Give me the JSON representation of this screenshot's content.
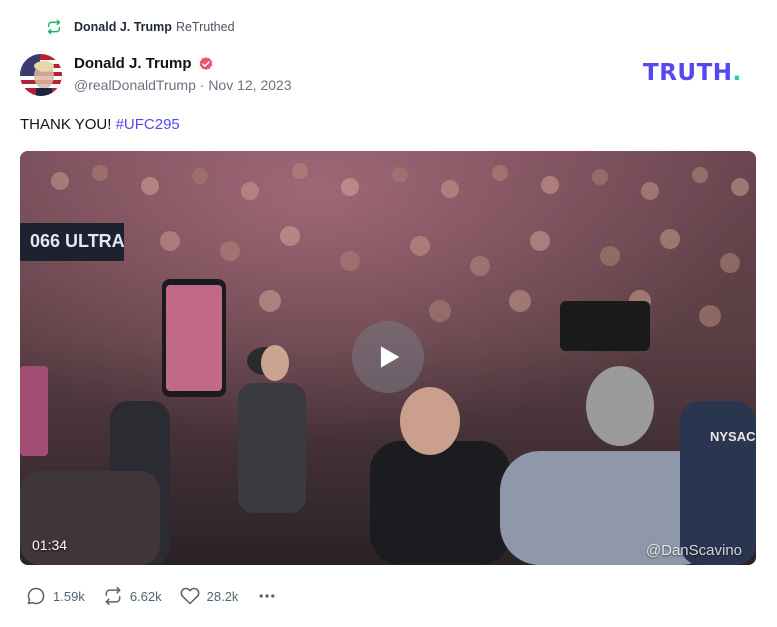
{
  "retruth": {
    "icon": "retruth-icon",
    "name": "Donald J. Trump",
    "label": "ReTruthed"
  },
  "author": {
    "avatar": "avatar-flag-portrait",
    "name": "Donald J. Trump",
    "handle": "@realDonaldTrump",
    "separator": "·",
    "date": "Nov 12, 2023",
    "verified_icon": "verified-badge-icon"
  },
  "brand": {
    "logo_text": "TRUTH",
    "logo_dot": ".",
    "color": "#5448ee",
    "dot_color": "#19d3a2"
  },
  "post": {
    "text": "THANK YOU!",
    "hashtag": "#UFC295"
  },
  "media": {
    "type": "video",
    "duration": "01:34",
    "watermark": "@DanScavino",
    "play_icon": "play-icon"
  },
  "actions": {
    "replies": "1.59k",
    "retruths": "6.62k",
    "likes": "28.2k",
    "more": "•••"
  }
}
